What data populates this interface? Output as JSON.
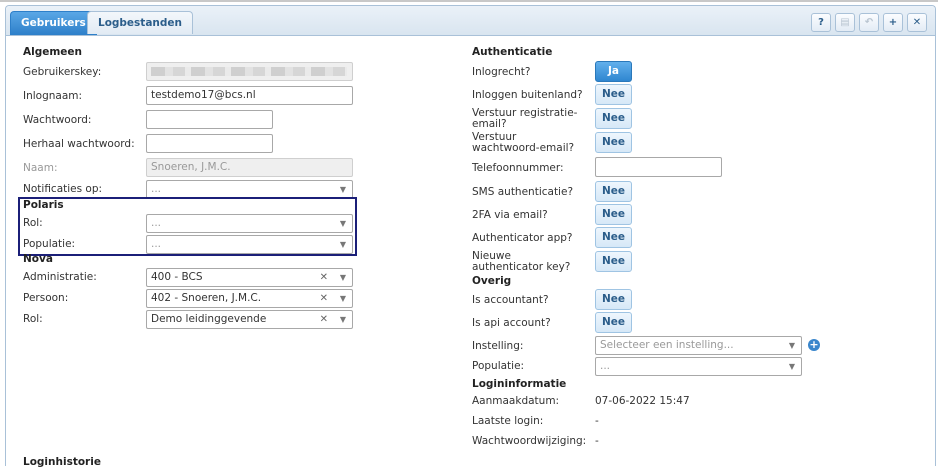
{
  "tabs": [
    {
      "label": "Gebruikers",
      "active": true
    },
    {
      "label": "Logbestanden",
      "active": false
    }
  ],
  "toolbar": {
    "help_label": "?",
    "save_label": "▤",
    "undo_label": "↶",
    "add_label": "+",
    "close_label": "✕"
  },
  "algemeen": {
    "section": "Algemeen",
    "gebruikerskey_label": "Gebruikerskey:",
    "inlognaam_label": "Inlognaam:",
    "inlognaam_value": "testdemo17@bcs.nl",
    "wachtwoord_label": "Wachtwoord:",
    "herhaal_label": "Herhaal wachtwoord:",
    "naam_label": "Naam:",
    "naam_value": "Snoeren, J.M.C.",
    "notificaties_label": "Notificaties op:",
    "notificaties_placeholder": "..."
  },
  "polaris": {
    "section": "Polaris",
    "rol_label": "Rol:",
    "rol_placeholder": "...",
    "populatie_label": "Populatie:",
    "populatie_placeholder": "..."
  },
  "nova": {
    "section": "Nova",
    "administratie_label": "Administratie:",
    "administratie_value": "400 - BCS",
    "persoon_label": "Persoon:",
    "persoon_value": "402 - Snoeren, J.M.C.",
    "rol_label": "Rol:",
    "rol_value": "Demo leidinggevende"
  },
  "loginhistorie": {
    "section": "Loginhistorie"
  },
  "authenticatie": {
    "section": "Authenticatie",
    "inlogrecht_label": "Inlogrecht?",
    "inlogrecht_value": "Ja",
    "buitenland_label": "Inloggen buitenland?",
    "buitenland_value": "Nee",
    "registratie_label": "Verstuur registratie-email?",
    "registratie_value": "Nee",
    "wachtwoord_email_label": "Verstuur wachtwoord-email?",
    "wachtwoord_email_value": "Nee",
    "telefoon_label": "Telefoonnummer:",
    "telefoon_value": "",
    "sms_label": "SMS authenticatie?",
    "sms_value": "Nee",
    "twofa_label": "2FA via email?",
    "twofa_value": "Nee",
    "app_label": "Authenticator app?",
    "app_value": "Nee",
    "nieuwe_key_label": "Nieuwe authenticator key?",
    "nieuwe_key_value": "Nee"
  },
  "overig": {
    "section": "Overig",
    "accountant_label": "Is accountant?",
    "accountant_value": "Nee",
    "api_label": "Is api account?",
    "api_value": "Nee",
    "instelling_label": "Instelling:",
    "instelling_placeholder": "Selecteer een instelling...",
    "populatie_label": "Populatie:",
    "populatie_placeholder": "..."
  },
  "logininformatie": {
    "section": "Logininformatie",
    "aanmaakdatum_label": "Aanmaakdatum:",
    "aanmaakdatum_value": "07-06-2022 15:47",
    "laatste_login_label": "Laatste login:",
    "laatste_login_value": "-",
    "wachtwoordwijziging_label": "Wachtwoordwijziging:",
    "wachtwoordwijziging_value": "-"
  }
}
